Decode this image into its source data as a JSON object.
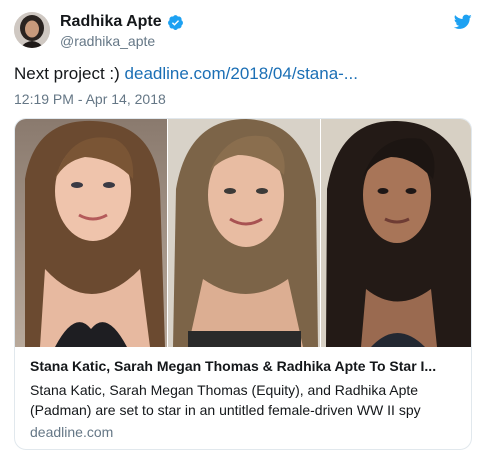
{
  "author": {
    "display_name": "Radhika Apte",
    "handle": "@radhika_apte",
    "avatar": "avatar-photo",
    "verified_icon": "verified-badge-icon"
  },
  "brand_icon": "twitter-bird-icon",
  "tweet": {
    "text": "Next project :) ",
    "link_text": "deadline.com/2018/04/stana-...",
    "timestamp": "12:19 PM - Apr 14, 2018"
  },
  "card": {
    "image": "three-portrait-photos",
    "title": "Stana Katic, Sarah Megan Thomas & Radhika Apte To Star I...",
    "description": "Stana Katic, Sarah Megan Thomas (Equity), and Radhika Apte (Padman) are set to star in an untitled female-driven WW II spy",
    "domain": "deadline.com"
  },
  "colors": {
    "link": "#1b6fb5",
    "verified": "#1da1f2",
    "secondary_text": "#657786",
    "border": "#e1e8ed"
  }
}
